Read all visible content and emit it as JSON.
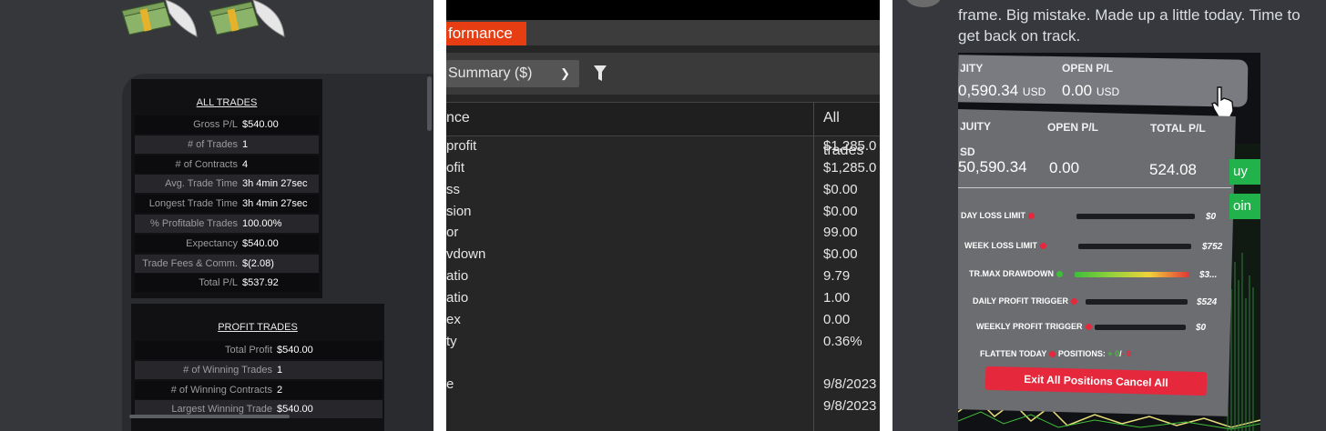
{
  "panel1": {
    "all_trades": {
      "title": "ALL TRADES",
      "rows": [
        {
          "label": "Gross P/L",
          "value": "$540.00"
        },
        {
          "label": "# of Trades",
          "value": "1"
        },
        {
          "label": "# of Contracts",
          "value": "4"
        },
        {
          "label": "Avg. Trade Time",
          "value": "3h 4min 27sec"
        },
        {
          "label": "Longest Trade Time",
          "value": "3h 4min 27sec"
        },
        {
          "label": "% Profitable Trades",
          "value": "100.00%"
        },
        {
          "label": "Expectancy",
          "value": "$540.00"
        },
        {
          "label": "Trade Fees & Comm.",
          "value": "$(2.08)"
        },
        {
          "label": "Total P/L",
          "value": "$537.92"
        }
      ]
    },
    "profit_trades": {
      "title": "PROFIT TRADES",
      "rows": [
        {
          "label": "Total Profit",
          "value": "$540.00"
        },
        {
          "label": "# of Winning Trades",
          "value": "1"
        },
        {
          "label": "# of Winning Contracts",
          "value": "2"
        },
        {
          "label": "Largest Winning Trade",
          "value": "$540.00"
        }
      ]
    }
  },
  "panel2": {
    "tab_label": "formance",
    "dropdown_value": "Summary ($)",
    "header_left": "nce",
    "header_right": "All trades",
    "rows": [
      {
        "label": "profit",
        "value": "$1,285.0"
      },
      {
        "label": "ofit",
        "value": "$1,285.0"
      },
      {
        "label": "ss",
        "value": "$0.00"
      },
      {
        "label": "sion",
        "value": "$0.00"
      },
      {
        "label": "or",
        "value": "99.00"
      },
      {
        "label": "vdown",
        "value": "$0.00"
      },
      {
        "label": "atio",
        "value": "9.79"
      },
      {
        "label": "atio",
        "value": "1.00"
      },
      {
        "label": "ex",
        "value": "0.00"
      },
      {
        "label": "ty",
        "value": "0.36%"
      },
      {
        "label": "e",
        "value": "9/8/2023"
      },
      {
        "label": "",
        "value": "9/8/2023"
      }
    ]
  },
  "panel3": {
    "message_lines": [
      "frame. Big mistake. Made up a little today. Time to",
      "get back on track."
    ],
    "top_strip": {
      "equity_label": "JITY",
      "equity_value": "0,590.34",
      "equity_unit": "USD",
      "open_label": "OPEN P/L",
      "open_value": "0.00",
      "open_unit": "USD"
    },
    "main": {
      "equity_label": "JUITY",
      "open_label": "OPEN P/L",
      "total_label": "TOTAL P/L",
      "currency": "SD",
      "equity_value": "50,590.34",
      "open_value": "0.00",
      "total_value": "524.08"
    },
    "limits": [
      {
        "label": "DAY LOSS LIMIT",
        "value": "$0",
        "dot": "#e5283c"
      },
      {
        "label": "WEEK LOSS LIMIT",
        "value": "$752",
        "dot": "#e5283c"
      },
      {
        "label": "TR.MAX DRAWDOWN",
        "value": "$3...",
        "dot": "#3fbf39"
      },
      {
        "label": "DAILY PROFIT TRIGGER",
        "value": "$524",
        "dot": "#e5283c"
      },
      {
        "label": "WEEKLY PROFIT TRIGGER",
        "value": "$0",
        "dot": "#e5283c"
      }
    ],
    "flatten_label": "FLATTEN TODAY",
    "positions_label": "POSITIONS:",
    "positions_plus": "+ 0",
    "positions_minus": "- 0",
    "exit_button": "Exit All Positions Cancel All",
    "side_buttons": [
      "uy",
      "oin"
    ]
  },
  "colors": {
    "accent_orange": "#e63e12",
    "exit_red": "#e5283c",
    "green": "#22b24c"
  }
}
